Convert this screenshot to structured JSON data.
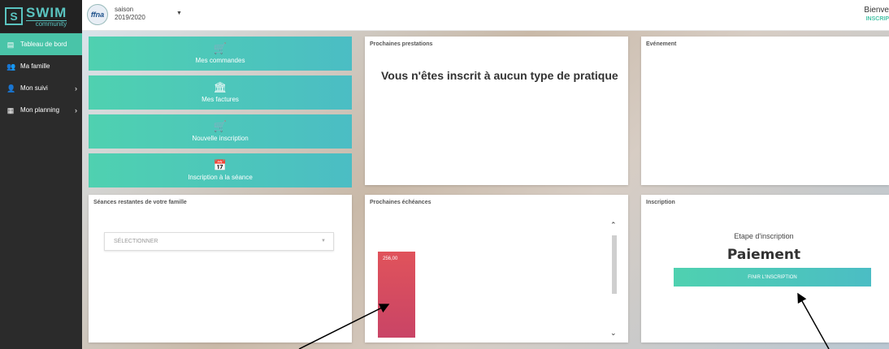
{
  "brand": {
    "mark": "S",
    "name": "SWIM",
    "tagline": "community"
  },
  "topbar": {
    "club_logo": "ffna",
    "season_label": "saison",
    "season_value": "2019/2020",
    "welcome": "Bienve",
    "welcome_sub": "INSCRIP"
  },
  "sidebar": {
    "items": [
      {
        "label": "Tableau de bord",
        "icon": "dashboard-icon"
      },
      {
        "label": "Ma famille",
        "icon": "family-icon"
      },
      {
        "label": "Mon suivi",
        "icon": "tracking-icon"
      },
      {
        "label": "Mon planning",
        "icon": "calendar-icon"
      }
    ]
  },
  "actions": [
    {
      "label": "Mes commandes",
      "icon": "cart-icon"
    },
    {
      "label": "Mes factures",
      "icon": "bank-icon"
    },
    {
      "label": "Nouvelle inscription",
      "icon": "cart-add-icon"
    },
    {
      "label": "Inscription à la séance",
      "icon": "calendar-plus-icon"
    }
  ],
  "cards": {
    "prestations": {
      "title": "Prochaines prestations",
      "message": "Vous n'êtes inscrit à aucun type de pratique"
    },
    "evenement": {
      "title": "Evénement"
    },
    "seances": {
      "title": "Séances restantes de votre famille",
      "select_value": "SÉLECTIONNER"
    },
    "echeances": {
      "title": "Prochaines échéances",
      "bar_value": "256,00"
    },
    "inscription": {
      "title": "Inscription",
      "step_label": "Etape d'inscription",
      "step_value": "Paiement",
      "button": "FINIR L'INSCRIPTION"
    }
  },
  "colors": {
    "accent": "#49c4a8",
    "bar": "#d04a62",
    "sidebar": "#2b2b2b"
  }
}
